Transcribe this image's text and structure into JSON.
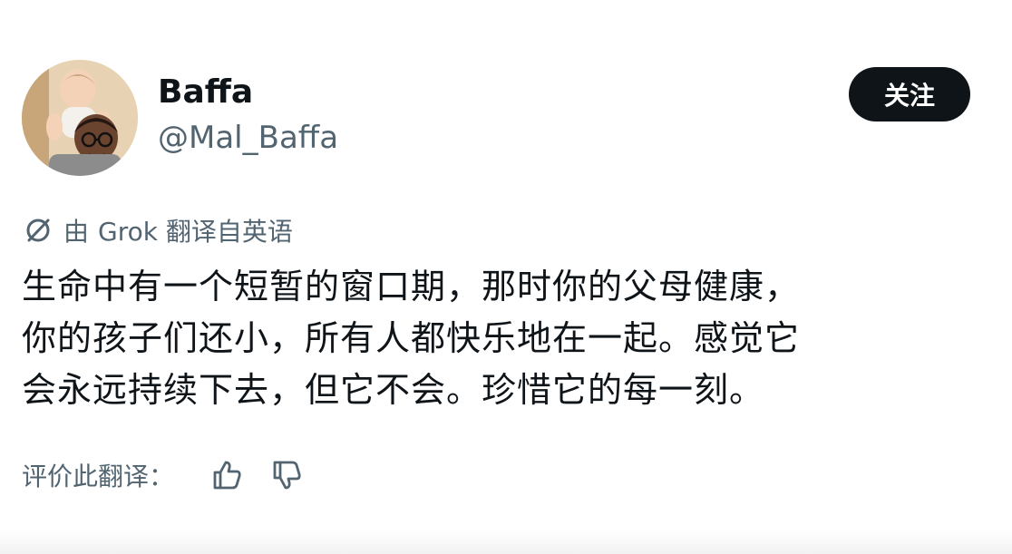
{
  "profile": {
    "display_name": "Baffa",
    "handle": "@Mal_Baffa",
    "follow_label": "关注"
  },
  "translation": {
    "icon": "translate-icon",
    "prefix": "由",
    "source": "Grok 翻译自英语"
  },
  "post": {
    "lines": [
      "生命中有一个短暂的窗口期，那时你的父母健康，",
      "你的孩子们还小，所有人都快乐地在一起。感觉它",
      "会永远持续下去，但它不会。珍惜它的每一刻。"
    ]
  },
  "rating": {
    "label": "评价此翻译：",
    "like_icon": "thumbs-up-icon",
    "dislike_icon": "thumbs-down-icon"
  },
  "colors": {
    "text": "#0f1419",
    "secondary": "#536471",
    "button_bg": "#0f1419",
    "button_text": "#ffffff"
  }
}
